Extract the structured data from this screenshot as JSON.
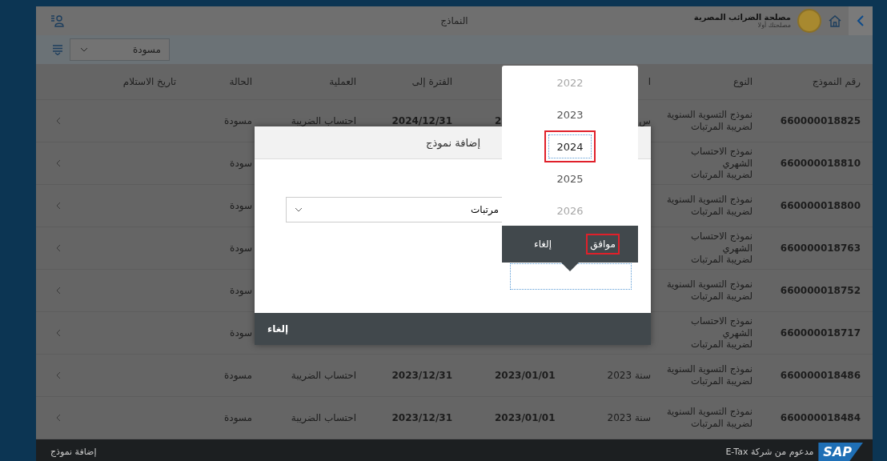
{
  "top_bar": {
    "title": "النماذج",
    "org_name": "مصلحة الضرائب المصرية",
    "org_slogan": "مصلحتك أولا"
  },
  "filter": {
    "value": "مسودة"
  },
  "table": {
    "columns": {
      "number": "رقم النموذج",
      "type": "النوع",
      "column_3": "ا",
      "period_to": "الفترة إلى",
      "operation": "العملية",
      "status": "الحالة",
      "receipt_date": "تاريخ الاستلام"
    },
    "rows": [
      {
        "number": "660000018825",
        "type": "نموذج التسوية السنوية\nلضريبة المرتبات",
        "column_3": "س",
        "period_from": "2",
        "period_to": "2024/12/31",
        "operation": "احتساب الضريبة",
        "status": "مسودة"
      },
      {
        "number": "660000018810",
        "type": "نموذج الاحتساب الشهري\nلضريبة المرتبات",
        "status": "سودة"
      },
      {
        "number": "660000018800",
        "type": "نموذج التسوية السنوية\nلضريبة المرتبات",
        "status": "سودة"
      },
      {
        "number": "660000018763",
        "type": "نموذج الاحتساب الشهري\nلضريبة المرتبات",
        "status": "سودة"
      },
      {
        "number": "660000018752",
        "type": "نموذج التسوية السنوية\nلضريبة المرتبات",
        "status": "سودة"
      },
      {
        "number": "660000018717",
        "type": "نموذج الاحتساب الشهري\nلضريبة المرتبات",
        "status": "سودة"
      },
      {
        "number": "660000018486",
        "type": "نموذج التسوية السنوية\nلضريبة المرتبات",
        "column_3": "سنة 2023",
        "period_from": "2023/01/01",
        "period_to": "2023/12/31",
        "operation": "احتساب الضريبة",
        "status": "مسودة"
      },
      {
        "number": "660000018484",
        "type": "نموذج التسوية السنوية\nلضريبة المرتبات",
        "column_3": "سنة 2023",
        "period_from": "2023/01/01",
        "period_to": "2023/12/31",
        "operation": "احتساب الضريبة",
        "status": "مسودة"
      }
    ]
  },
  "footer": {
    "logo_text": "SAP",
    "powered_by": "مدعوم من شركة E-Tax",
    "add_button": "إضافة نموذج"
  },
  "dialog": {
    "title": "إضافة نموذج",
    "select_value": "مرتبات",
    "cancel_button": "إلغاء"
  },
  "year_picker": {
    "years": [
      {
        "label": "2022",
        "selected": false,
        "marked": false
      },
      {
        "label": "2023",
        "selected": false,
        "marked": false
      },
      {
        "label": "2024",
        "selected": true,
        "marked": true
      },
      {
        "label": "2025",
        "selected": false,
        "marked": false
      },
      {
        "label": "2026",
        "selected": false,
        "marked": false
      }
    ],
    "ok_button": {
      "label": "موافق",
      "marked": true
    },
    "cancel_button": {
      "label": "إلغاء",
      "marked": false
    }
  }
}
